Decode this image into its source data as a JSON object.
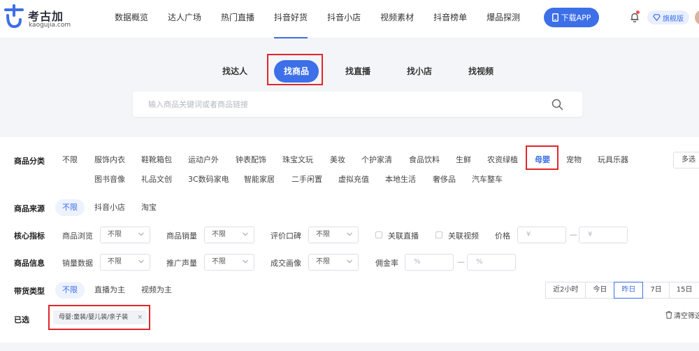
{
  "header": {
    "logo_cn": "考古加",
    "logo_en": "kaogujia.com",
    "nav": [
      "数据概览",
      "达人广场",
      "热门直播",
      "抖音好货",
      "抖音小店",
      "视频素材",
      "抖音榜单",
      "爆品探测"
    ],
    "active_nav": "抖音好货",
    "download_label": "下载APP",
    "flagship_label": "旗舰版"
  },
  "search": {
    "tabs": [
      "找达人",
      "找商品",
      "找直播",
      "找小店",
      "找视频"
    ],
    "active_tab": "找商品",
    "placeholder": "输入商品关键词或者商品链接"
  },
  "filters": {
    "category": {
      "label": "商品分类",
      "row1": [
        "不限",
        "服饰内衣",
        "鞋靴箱包",
        "运动户外",
        "钟表配饰",
        "珠宝文玩",
        "美妆",
        "个护家清",
        "食品饮料",
        "生鲜",
        "农资绿植",
        "母婴",
        "宠物",
        "玩具乐器"
      ],
      "row2": [
        "图书音像",
        "礼品文创",
        "3C数码家电",
        "智能家居",
        "二手闲置",
        "虚拟充值",
        "本地生活",
        "奢侈品",
        "汽车整车"
      ],
      "selected": "母婴",
      "multi_label": "多选"
    },
    "source": {
      "label": "商品来源",
      "options": [
        "不限",
        "抖音小店",
        "淘宝"
      ],
      "selected": "不限"
    },
    "core": {
      "label": "核心指标",
      "browse_label": "商品浏览",
      "browse_value": "不限",
      "sales_label": "商品销量",
      "sales_value": "不限",
      "review_label": "评价口碑",
      "review_value": "不限",
      "live_check": "关联直播",
      "video_check": "关联视频",
      "price_label": "价格",
      "price_min": "¥",
      "price_max": "¥",
      "range_sep": "—"
    },
    "info": {
      "label": "商品信息",
      "sales_data_label": "销量数据",
      "sales_data_value": "不限",
      "promo_label": "推广声量",
      "promo_value": "不限",
      "portrait_label": "成交画像",
      "portrait_value": "不限",
      "commission_label": "佣金率",
      "commission_min": "%",
      "commission_max": "%",
      "range_sep": "—"
    },
    "type": {
      "label": "带货类型",
      "options": [
        "不限",
        "直播为主",
        "视频为主"
      ],
      "selected": "不限"
    },
    "time": {
      "options": [
        "近2小时",
        "今日",
        "昨日",
        "7日",
        "15日"
      ],
      "selected": "昨日"
    },
    "selected_tags": {
      "label": "已选",
      "tag": "母婴:童装/婴儿装/亲子装",
      "clear_label": "清空筛选"
    }
  },
  "colors": {
    "accent": "#3c6fe8",
    "highlight": "#e0262b"
  }
}
